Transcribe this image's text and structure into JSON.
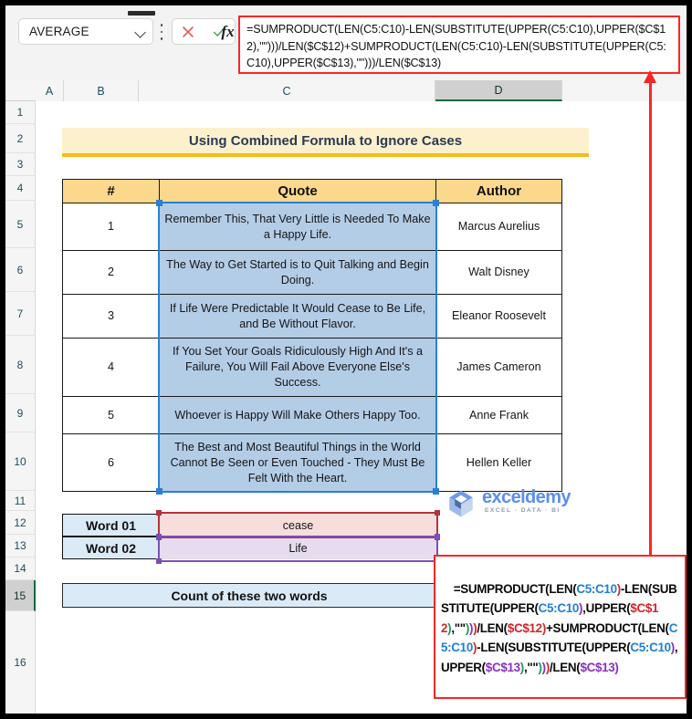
{
  "formula_bar": {
    "name_box_value": "AVERAGE",
    "cancel_icon": "cancel-x-icon",
    "confirm_icon": "confirm-check-icon",
    "fx_label": "fx",
    "formula_text": "=SUMPRODUCT(LEN(C5:C10)-LEN(SUBSTITUTE(UPPER(C5:C10),UPPER($C$12),\"\")))/LEN($C$12)+SUMPRODUCT(LEN(C5:C10)-LEN(SUBSTITUTE(UPPER(C5:C10),UPPER($C$13),\"\")))/LEN($C$13)"
  },
  "grid": {
    "columns": [
      "A",
      "B",
      "C",
      "D"
    ],
    "selected_column": "D",
    "rows": [
      "1",
      "2",
      "3",
      "4",
      "5",
      "6",
      "7",
      "8",
      "9",
      "10",
      "11",
      "12",
      "13",
      "14",
      "15",
      "16"
    ],
    "selected_row": "15"
  },
  "sheet": {
    "title_banner": "Using Combined Formula to Ignore Cases",
    "table": {
      "headers": [
        "#",
        "Quote",
        "Author"
      ],
      "rows": [
        {
          "num": "1",
          "quote": "Remember This, That Very Little is Needed To Make a Happy Life.",
          "author": "Marcus Aurelius"
        },
        {
          "num": "2",
          "quote": "The Way to Get Started is to Quit Talking and Begin Doing.",
          "author": "Walt Disney"
        },
        {
          "num": "3",
          "quote": "If Life Were Predictable It Would Cease to Be Life, and Be Without Flavor.",
          "author": "Eleanor Roosevelt"
        },
        {
          "num": "4",
          "quote": "If You Set Your Goals Ridiculously High And It's a Failure, You Will Fail Above Everyone Else's Success.",
          "author": "James Cameron"
        },
        {
          "num": "5",
          "quote": "Whoever is Happy Will Make Others Happy Too.",
          "author": "Anne Frank"
        },
        {
          "num": "6",
          "quote": "The Best and Most Beautiful Things in the World Cannot Be Seen or Even Touched - They Must Be Felt With the Heart.",
          "author": "Hellen Keller"
        }
      ]
    },
    "words": [
      {
        "label": "Word 01",
        "value": "cease"
      },
      {
        "label": "Word 02",
        "value": "Life"
      }
    ],
    "count_label": "Count of these two words",
    "result_formula_parts": [
      {
        "t": "=SUMPRODUCT(LEN(",
        "c": "black"
      },
      {
        "t": "C5:C10",
        "c": "blue"
      },
      {
        "t": ")",
        "c": "red"
      },
      {
        "t": "-LEN(",
        "c": "black"
      },
      {
        "t": "SUBSTITUTE(UPPER(",
        "c": "black"
      },
      {
        "t": "C5:C10",
        "c": "blue"
      },
      {
        "t": ")",
        "c": "purple"
      },
      {
        "t": ",",
        "c": "black"
      },
      {
        "t": "UPPER(",
        "c": "black"
      },
      {
        "t": "$C$12",
        "c": "red"
      },
      {
        "t": ")",
        "c": "green"
      },
      {
        "t": ",\"\"",
        "c": "black"
      },
      {
        "t": ")",
        "c": "green"
      },
      {
        "t": ")",
        "c": "purple"
      },
      {
        "t": ")",
        "c": "red"
      },
      {
        "t": "/LEN(",
        "c": "black"
      },
      {
        "t": "$C$12",
        "c": "red"
      },
      {
        "t": ")",
        "c": "red"
      },
      {
        "t": "+",
        "c": "black"
      },
      {
        "t": "SUMPRODUCT(LEN(",
        "c": "black"
      },
      {
        "t": "C5:C10",
        "c": "blue"
      },
      {
        "t": ")",
        "c": "red"
      },
      {
        "t": "-LEN(",
        "c": "black"
      },
      {
        "t": "SUBSTITUTE(UPPER(",
        "c": "black"
      },
      {
        "t": "C5:C10",
        "c": "blue"
      },
      {
        "t": ")",
        "c": "purple"
      },
      {
        "t": ",",
        "c": "black"
      },
      {
        "t": "UPPER(",
        "c": "black"
      },
      {
        "t": "$C$13",
        "c": "purple"
      },
      {
        "t": ")",
        "c": "green"
      },
      {
        "t": ",\"\"",
        "c": "black"
      },
      {
        "t": ")",
        "c": "green"
      },
      {
        "t": ")",
        "c": "purple"
      },
      {
        "t": ")",
        "c": "red"
      },
      {
        "t": "/LEN(",
        "c": "black"
      },
      {
        "t": "$C$13",
        "c": "purple"
      },
      {
        "t": ")",
        "c": "purple"
      }
    ]
  },
  "logo": {
    "word": "exceldemy",
    "tagline": "EXCEL · DATA · BI"
  },
  "annotation": {
    "arrow": "red-arrow-up",
    "accent_color": "#fb2525"
  }
}
